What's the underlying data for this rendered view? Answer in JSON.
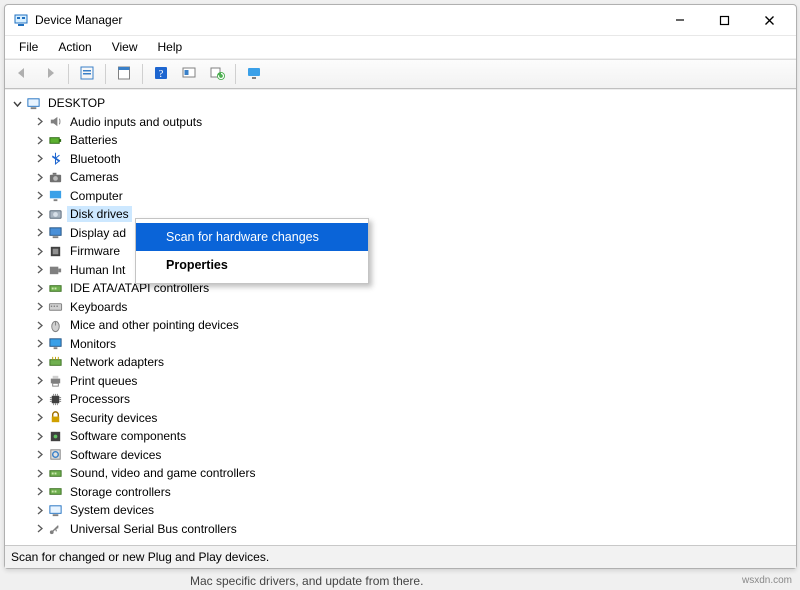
{
  "titlebar": {
    "title": "Device Manager"
  },
  "menubar": {
    "file": "File",
    "action": "Action",
    "view": "View",
    "help": "Help"
  },
  "tree": {
    "root": "DESKTOP",
    "items": [
      "Audio inputs and outputs",
      "Batteries",
      "Bluetooth",
      "Cameras",
      "Computer",
      "Disk drives",
      "Display adapters",
      "Firmware",
      "Human Interface Devices",
      "IDE ATA/ATAPI controllers",
      "Keyboards",
      "Mice and other pointing devices",
      "Monitors",
      "Network adapters",
      "Print queues",
      "Processors",
      "Security devices",
      "Software components",
      "Software devices",
      "Sound, video and game controllers",
      "Storage controllers",
      "System devices",
      "Universal Serial Bus controllers"
    ],
    "selected_index": 5,
    "display_overrides": {
      "6": "Display ad",
      "8": "Human Int"
    }
  },
  "context_menu": {
    "scan": "Scan for hardware changes",
    "properties": "Properties"
  },
  "status": {
    "text": "Scan for changed or new Plug and Play devices."
  },
  "background": {
    "under_text": "Mac specific drivers, and update from there.",
    "watermark": "wsxdn.com"
  }
}
